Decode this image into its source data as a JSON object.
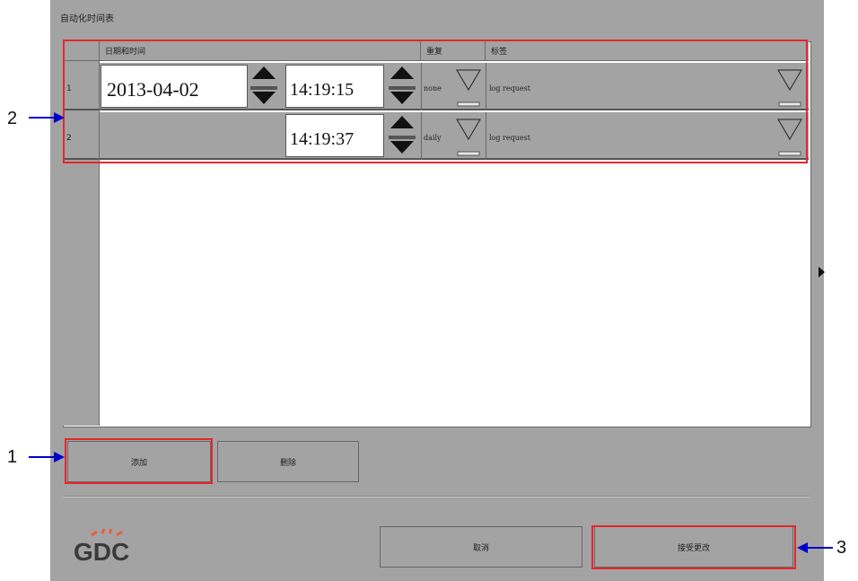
{
  "window": {
    "title": "自动化时间表"
  },
  "table": {
    "headers": {
      "datetime": "日期和时间",
      "repeat": "重复",
      "label": "标签"
    },
    "rows": [
      {
        "num": "1",
        "date": "2013-04-02",
        "time": "14:19:15",
        "repeat": "none",
        "label": "log request"
      },
      {
        "num": "2",
        "date": "",
        "time": "14:19:37",
        "repeat": "daily",
        "label": "log request"
      }
    ]
  },
  "buttons": {
    "add": "添加",
    "delete": "删除",
    "cancel": "取消",
    "accept": "接受更改"
  },
  "callouts": {
    "c1": "1",
    "c2": "2",
    "c3": "3"
  },
  "logo": {
    "text": "GDC"
  },
  "colors": {
    "highlight": "#e8252b",
    "callout_arrow": "#0000cc",
    "logo_accent": "#e8603a"
  }
}
